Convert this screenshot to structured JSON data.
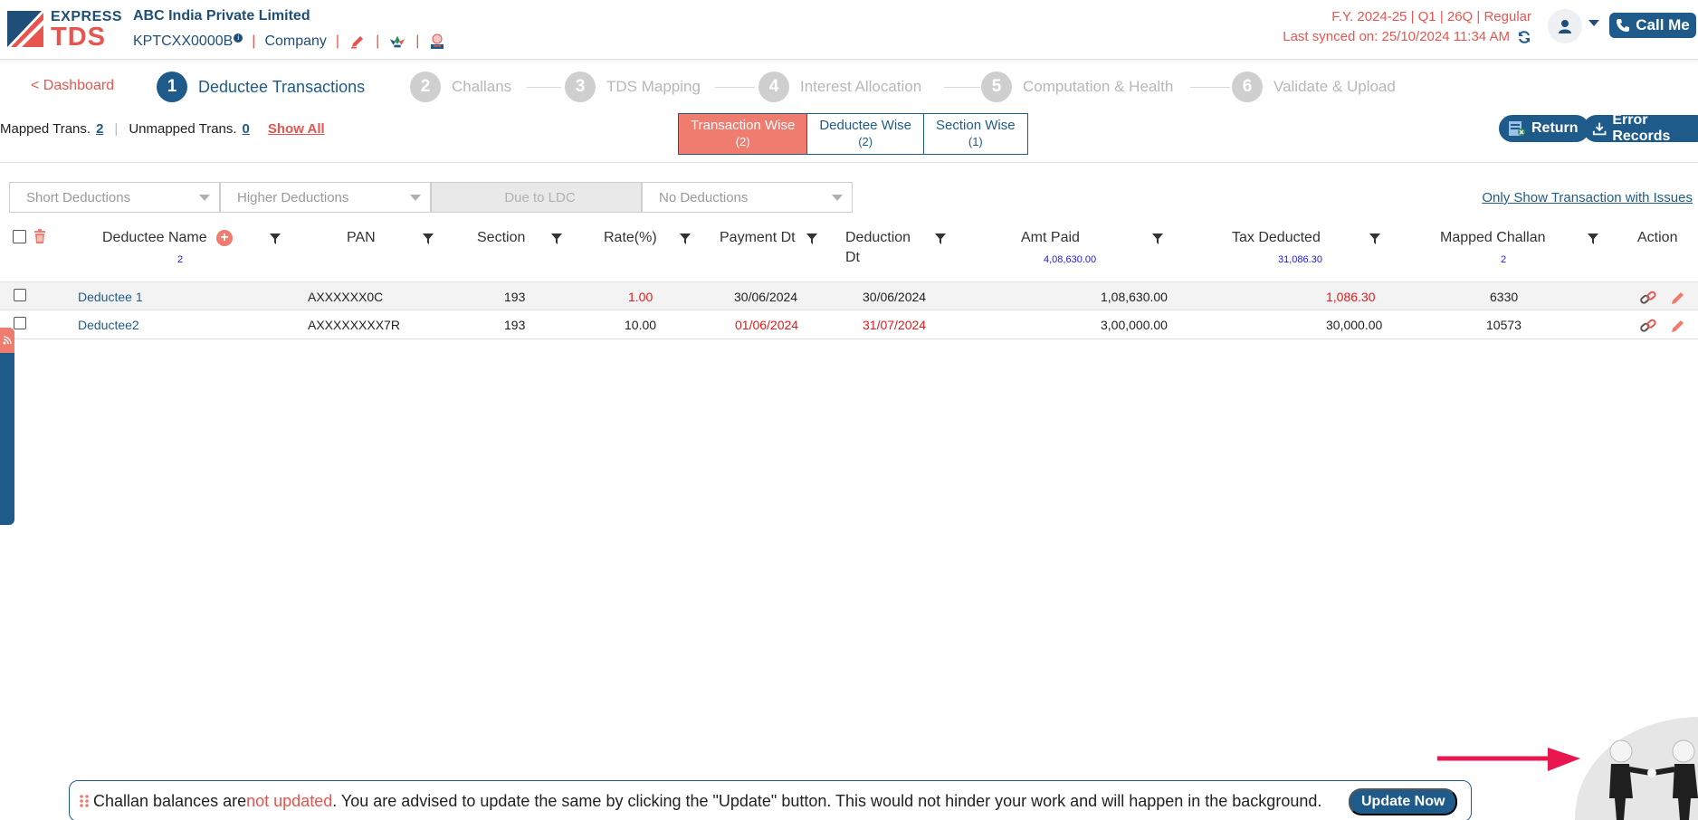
{
  "header": {
    "logo": {
      "express": "EXPRESS",
      "tds": "TDS"
    },
    "company_name": "ABC India Private Limited",
    "tan": "KPTCXX0000B",
    "info_badge": "i",
    "entity_type": "Company",
    "sep": "|",
    "fy_info": "F.Y. 2024-25  | Q1  | 26Q | Regular",
    "last_synced": "Last synced on: 25/10/2024 11:34 AM",
    "call_me": "Call Me"
  },
  "nav": {
    "dashboard": "< Dashboard",
    "steps": [
      {
        "num": "1",
        "label": "Deductee Transactions"
      },
      {
        "num": "2",
        "label": "Challans"
      },
      {
        "num": "3",
        "label": "TDS Mapping"
      },
      {
        "num": "4",
        "label": "Interest Allocation"
      },
      {
        "num": "5",
        "label": "Computation & Health"
      },
      {
        "num": "6",
        "label": "Validate & Upload"
      }
    ]
  },
  "toolbar": {
    "mapped_label": "Mapped Trans.",
    "mapped_count": "2",
    "pipe": "|",
    "unmapped_label": "Unmapped Trans.",
    "unmapped_count": "0",
    "show_all": "Show All",
    "views": [
      {
        "label": "Transaction Wise",
        "count": "(2)"
      },
      {
        "label": "Deductee Wise",
        "count": "(2)"
      },
      {
        "label": "Section Wise",
        "count": "(1)"
      }
    ],
    "return_label": "Return",
    "error_records_label": "Error Records"
  },
  "filters": {
    "short": "Short Deductions",
    "higher": "Higher Deductions",
    "ldc": "Due to LDC",
    "none": "No Deductions",
    "only_issues": "Only Show Transaction with Issues"
  },
  "table": {
    "headers": {
      "name": "Deductee Name",
      "name_count": "2",
      "add": "+",
      "pan": "PAN",
      "section": "Section",
      "rate": "Rate(%)",
      "payment_dt": "Payment Dt",
      "deduction_dt_1": "Deduction",
      "deduction_dt_2": "Dt",
      "amt_paid": "Amt Paid",
      "amt_paid_total": "4,08,630.00",
      "tax_deducted": "Tax Deducted",
      "tax_deducted_total": "31,086.30",
      "mapped_challan": "Mapped Challan",
      "mapped_challan_count": "2",
      "action": "Action"
    },
    "rows": [
      {
        "name": "Deductee 1",
        "pan": "AXXXXXX0C",
        "section": "193",
        "rate": "1.00",
        "payment_dt": "30/06/2024",
        "deduction_dt": "30/06/2024",
        "amt_paid": "1,08,630.00",
        "tax_deducted": "1,086.30",
        "mapped_challan": "6330"
      },
      {
        "name": "Deductee2",
        "pan": "AXXXXXXXX7R",
        "section": "193",
        "rate": "10.00",
        "payment_dt": "01/06/2024",
        "deduction_dt": "31/07/2024",
        "amt_paid": "3,00,000.00",
        "tax_deducted": "30,000.00",
        "mapped_challan": "10573"
      }
    ]
  },
  "banner": {
    "pre": "Challan balances are ",
    "hot": "not updated",
    "post": ". You are advised to update the same by clicking the \"Update\" button. This would not hinder your work and will happen in the background.",
    "button": "Update Now"
  },
  "colors": {
    "primary": "#1f5b8a",
    "accent": "#e8554e",
    "active_tab": "#f07b6f",
    "alert_red": "#e01b1b"
  }
}
